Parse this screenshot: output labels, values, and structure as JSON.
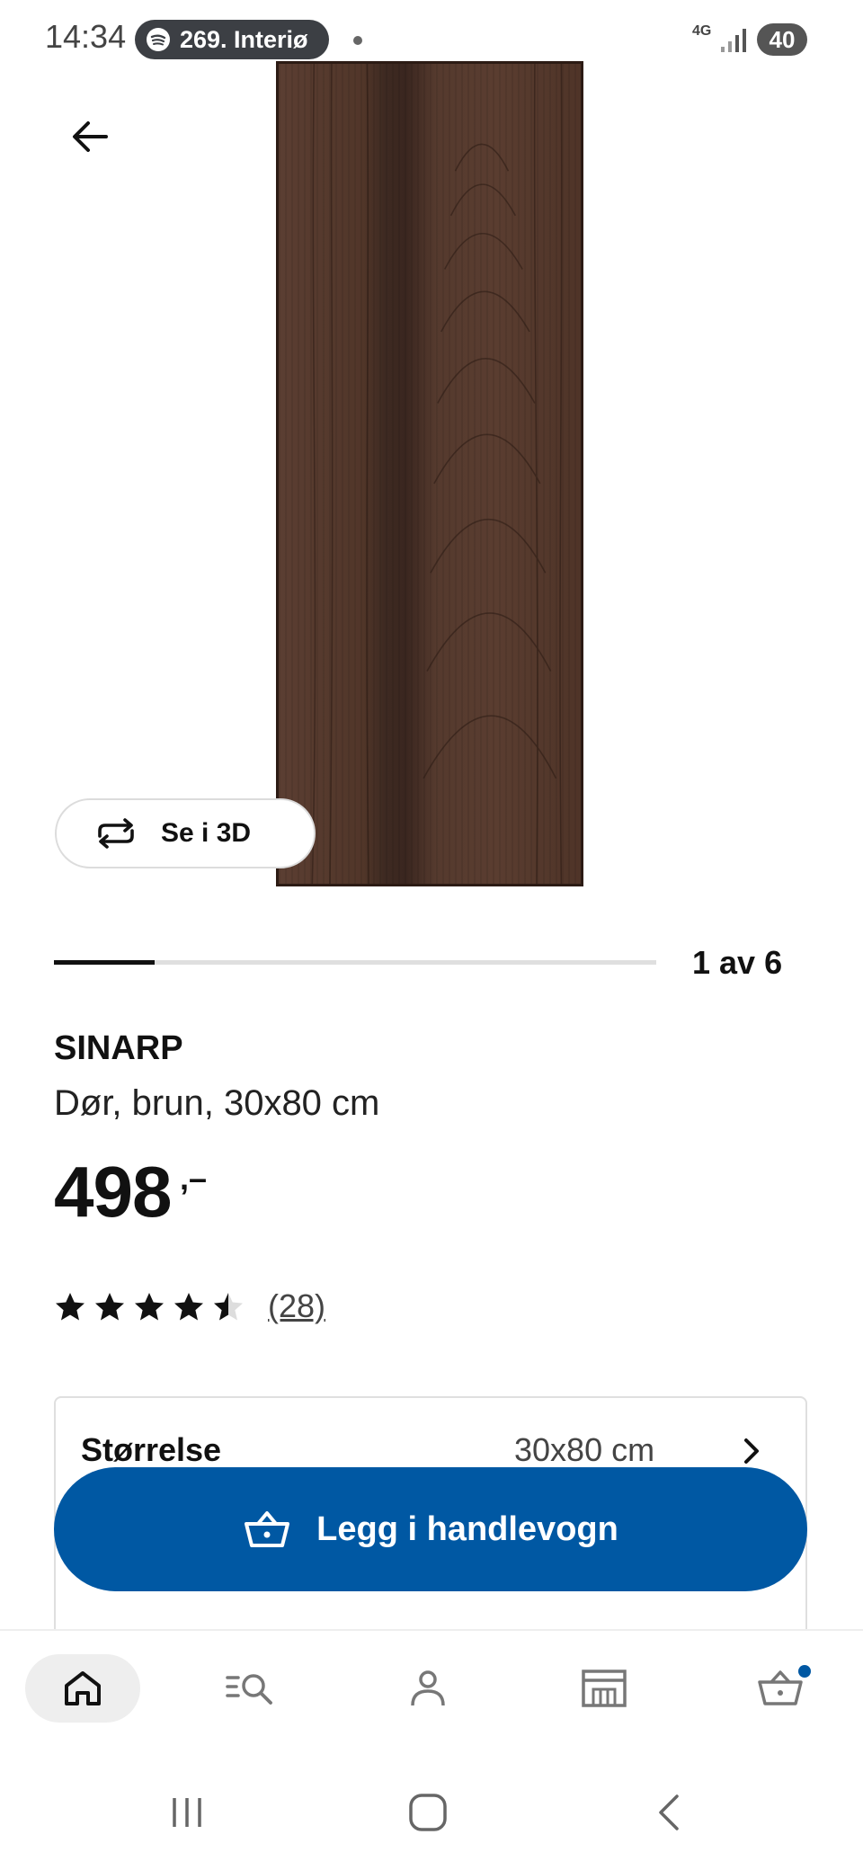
{
  "status_bar": {
    "time": "14:34",
    "media_text": "269. Interiø",
    "network": "4G",
    "battery": "40"
  },
  "product": {
    "three_d_label": "Se i 3D",
    "image_counter": "1 av 6",
    "image_progress_fraction": 0.167,
    "name": "SINARP",
    "description": "Dør, brun, 30x80 cm",
    "price": "498",
    "price_suffix": ",–",
    "rating": 4.5,
    "review_count": "(28)",
    "size_label": "Størrelse",
    "size_value": "30x80 cm",
    "add_to_cart_label": "Legg i handlevogn"
  },
  "colors": {
    "brand_blue": "#0058a3",
    "wood": "#4f3428"
  },
  "bottom_nav": [
    {
      "name": "home-icon",
      "active": true
    },
    {
      "name": "search-icon",
      "active": false
    },
    {
      "name": "profile-icon",
      "active": false
    },
    {
      "name": "store-icon",
      "active": false
    },
    {
      "name": "cart-icon",
      "active": false,
      "badge": true
    }
  ]
}
